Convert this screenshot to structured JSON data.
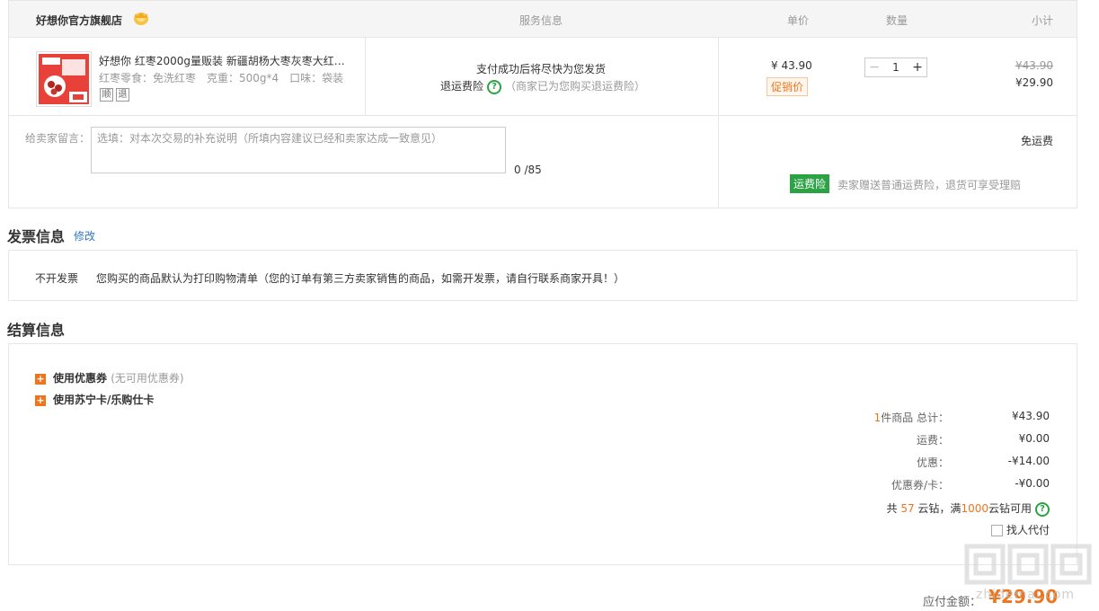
{
  "order": {
    "store_name": "好想你官方旗舰店",
    "headers": {
      "service": "服务信息",
      "price": "单价",
      "quantity": "数量",
      "subtotal": "小计"
    },
    "item": {
      "title": "好想你 红枣2000g量贩装 新疆胡杨大枣灰枣大红枣...",
      "spec": "红枣零食：免洗红枣　克重：500g*4　口味：袋装",
      "tags": [
        "顺",
        "退"
      ],
      "service_line1": "支付成功后将尽快为您发货",
      "service_insurance": "退运费险",
      "service_note": "（商家已为您购买退运费险）",
      "unit_price": "¥ 43.90",
      "promo_label": "促销价",
      "quantity": "1",
      "minus": "−",
      "plus": "+",
      "original_subtotal": "¥43.90",
      "subtotal": "¥29.90"
    },
    "message": {
      "label": "给卖家留言：",
      "placeholder": "选填：对本次交易的补充说明（所填内容建议已经和卖家达成一致意见）",
      "count": "0 /85"
    },
    "shipping": {
      "free": "免运费",
      "insurance_badge": "运费险",
      "insurance_text": "卖家赠送普通运费险，退货可享受理赔"
    }
  },
  "invoice": {
    "title": "发票信息",
    "edit": "修改",
    "type": "不开发票",
    "desc": "您购买的商品默认为打印购物清单（您的订单有第三方卖家销售的商品，如需开发票，请自行联系商家开具！）"
  },
  "settlement": {
    "title": "结算信息",
    "coupon_label": "使用优惠券",
    "coupon_hint": "(无可用优惠券)",
    "card_label": "使用苏宁卡/乐购仕卡",
    "summary": {
      "count": "1",
      "count_label": "件商品 总计：",
      "total": "¥43.90",
      "shipping_label": "运费：",
      "shipping": "¥0.00",
      "discount_label": "优惠：",
      "discount": "-¥14.00",
      "coupon_card_label": "优惠券/卡：",
      "coupon_card": "-¥0.00"
    },
    "coins": {
      "prefix": "共",
      "count": "57",
      "mid": "云钻，满",
      "threshold": "1000",
      "suffix": "云钻可用"
    },
    "proxy_pay": "找人代付",
    "payable_label": "应付金额：",
    "payable": "¥29.90"
  },
  "icons": {
    "store_badge": "gold-badge-icon",
    "help": "question-circle-icon",
    "plus_square": "plus-square-icon"
  },
  "colors": {
    "accent_orange": "#f0741c",
    "insurance_green": "#2ba244",
    "link_blue": "#2f78c5"
  },
  "watermark": "值 么 值",
  "watermark_text": "zhidemai.com"
}
